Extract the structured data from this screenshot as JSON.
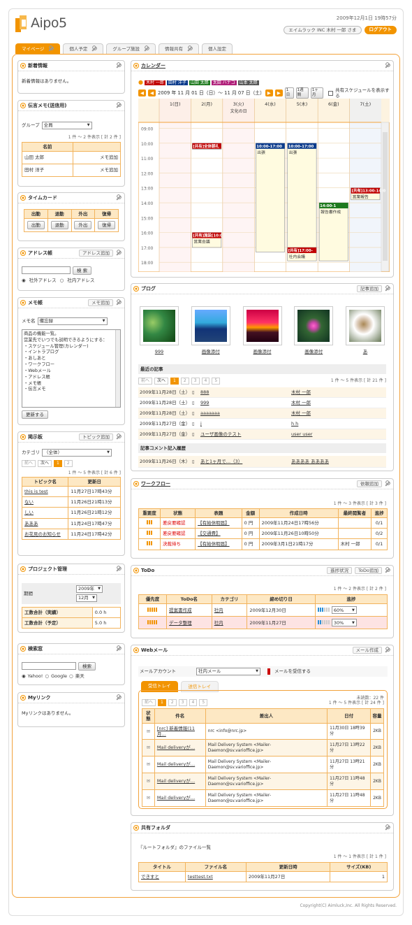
{
  "header": {
    "app": "Aipo5",
    "date": "2009年12月1日 19時57分",
    "user": "エイムラック INC 木村 一郎 さま",
    "logout": "ログアウト",
    "brand_colors": {
      "accent": "#f29400",
      "accent_light": "#fde8c4"
    }
  },
  "tabs": [
    {
      "label": "マイページ"
    },
    {
      "label": "個人予定"
    },
    {
      "label": "グループ施設"
    },
    {
      "label": "情報共有"
    },
    {
      "label": "個人設定"
    }
  ],
  "left": {
    "news": {
      "title": "新着情報",
      "empty": "新着情報はありません。"
    },
    "memo": {
      "title": "伝言メモ(送信用)",
      "group_label": "グループ",
      "group_value": "全員",
      "count": "1 件 ～ 2 件表示 [ 計 2 件 ]",
      "col": "名前",
      "rows": [
        {
          "name": "山田 太郎",
          "action": "メモ追加"
        },
        {
          "name": "田村 洋子",
          "action": "メモ追加"
        }
      ]
    },
    "timecard": {
      "title": "タイムカード",
      "headers": [
        "出勤",
        "退勤",
        "外出",
        "復帰"
      ],
      "buttons": [
        "出勤",
        "退勤",
        "外出",
        "復帰"
      ]
    },
    "address": {
      "title": "アドレス帳",
      "add": "アドレス追加",
      "search": "検 索",
      "r1": "社外アドレス",
      "r2": "社内アドレス"
    },
    "notepad": {
      "title": "メモ帳",
      "add": "メモ追加",
      "label": "メモ名",
      "value": "備忘録",
      "text": [
        "商品の機能一覧。",
        "営業先でいつでも説明できるようにする：",
        "・スケジュール管理(カレンダー)",
        "・イントラブログ",
        "・あしあと",
        "・ワークフロー",
        "・Webメール",
        "・アドレス帳",
        "・メモ帳",
        "・伝言メモ"
      ],
      "update": "更新する"
    },
    "board": {
      "title": "掲示板",
      "add": "トピック追加",
      "cat_label": "カテゴリ",
      "cat_value": "（全体）",
      "prev": "前へ",
      "next": "次へ",
      "p1": "1",
      "p2": "2",
      "count": "1 件 ～ 5 件表示 [ 計 6 件 ]",
      "h1": "トピック名",
      "h2": "更新日",
      "rows": [
        {
          "t": "this is test",
          "d": "11月27日17時43分"
        },
        {
          "t": "ない",
          "d": "11月26日21時13分"
        },
        {
          "t": "しい",
          "d": "11月26日21時12分"
        },
        {
          "t": "あああ",
          "d": "11月24日17時47分"
        },
        {
          "t": "お花見のお知らせ",
          "d": "11月24日17時42分"
        }
      ]
    },
    "project": {
      "title": "プロジェクト管理",
      "period": "期間",
      "year": "2009年",
      "month": "12月",
      "rows": [
        {
          "l": "工数合計（実績）",
          "v": "0.0 h"
        },
        {
          "l": "工数合計（予定）",
          "v": "5.0 h"
        }
      ]
    },
    "search": {
      "title": "検索窓",
      "btn": "検索",
      "r1": "Yahoo!",
      "r2": "Google",
      "r3": "楽天"
    },
    "links": {
      "title": "Myリンク",
      "empty": "Myリンクはありません。"
    }
  },
  "calendar": {
    "title": "カレンダー",
    "people": [
      {
        "n": "木村 一郎",
        "c": "#c00000"
      },
      {
        "n": "田村 洋子",
        "c": "#0b3b8c"
      },
      {
        "n": "山田 太郎",
        "c": "#1e7a1e"
      },
      {
        "n": "太田 ハナコ",
        "c": "#b0207a"
      },
      {
        "n": "山本 太郎",
        "c": "#555555"
      }
    ],
    "range": "2009 年 11 月 01 日（日）～ 11 月 07 日（土）",
    "shared": "共有スケジュールを表示する",
    "views": [
      "1日",
      "1週間",
      "1ヶ月"
    ],
    "days": [
      "1(日)",
      "2(月)",
      "3(火)",
      "4(水)",
      "5(木)",
      "6(金)",
      "7(土)"
    ],
    "holiday": "文化の日",
    "hours": [
      "09:00",
      "10:00",
      "11:00",
      "12:00",
      "13:00",
      "14:00",
      "15:00",
      "16:00",
      "17:00",
      "18:00"
    ],
    "events": [
      {
        "day": 1,
        "start": 10.0,
        "end": 10.4,
        "label": "[共有]全体朝礼",
        "c": "#c00000",
        "text": ""
      },
      {
        "day": 1,
        "start": 16.0,
        "end": 17.0,
        "label": "[共有]施設[10:0",
        "c": "#c00000",
        "text": "営業会議"
      },
      {
        "day": 3,
        "start": 10.0,
        "end": 17.3,
        "label": "10:00-17:00",
        "c": "#0b3b8c",
        "text": "出張"
      },
      {
        "day": 4,
        "start": 10.0,
        "end": 17.3,
        "label": "10:00-17:00",
        "c": "#0b3b8c",
        "text": "出張"
      },
      {
        "day": 4,
        "start": 17.0,
        "end": 17.9,
        "label": "[共有]17:00-",
        "c": "#c00000",
        "text": "社内会議"
      },
      {
        "day": 5,
        "start": 14.0,
        "end": 17.9,
        "label": "14:00-1",
        "c": "#1e7a1e",
        "text": "報告書作成"
      },
      {
        "day": 6,
        "start": 13.0,
        "end": 13.8,
        "label": "[共有]13:00-14:0",
        "c": "#c00000",
        "text": "営業報告"
      }
    ]
  },
  "blog": {
    "title": "ブログ",
    "add": "記事追加",
    "thumbs": [
      "999",
      "画像添付",
      "画像添付",
      "画像添付",
      "あ"
    ],
    "recent": "最近の記事",
    "count": "1 件 ～ 5 件表示 [ 計 21 件 ]",
    "pages": [
      "1",
      "2",
      "3",
      "4",
      "5"
    ],
    "prev": "前へ",
    "next": "次へ",
    "rows": [
      {
        "d": "2009年11月28日（土）",
        "t": "888",
        "a": "木村 一郎"
      },
      {
        "d": "2009年11月28日（土）",
        "t": "999",
        "a": "木村 一郎"
      },
      {
        "d": "2009年11月28日（土）",
        "t": "aaaaaaa",
        "a": "木村 一郎"
      },
      {
        "d": "2009年11月27日（金）",
        "t": "j",
        "a": "h h"
      },
      {
        "d": "2009年11月27日（金）",
        "t": "ユーザ画像のテスト",
        "a": "user user"
      }
    ],
    "comments": "記事コメント記入履歴",
    "crow": {
      "d": "2009年11月26日（木）",
      "t": "あと1ヶ月で…（3）",
      "a": "ああああ ああああ"
    }
  },
  "workflow": {
    "title": "ワークフロー",
    "add": "依頼追加",
    "count": "1 件 ～ 3 件表示 [ 計 3 件 ]",
    "headers": [
      "重要度",
      "状態",
      "表題",
      "金額",
      "作成日時",
      "最終閲覧者",
      "進捗"
    ],
    "rows": [
      {
        "s": "差戻要確認",
        "t": "【有給休暇届】",
        "m": "0 円",
        "d": "2009年11月24日17時56分",
        "v": "",
        "p": "0/1"
      },
      {
        "s": "差戻要確認",
        "t": "【交通費】",
        "m": "0 円",
        "d": "2009年11月26日10時50分",
        "v": "",
        "p": "0/2"
      },
      {
        "s": "決裁待ち",
        "t": "【有給休暇届】",
        "m": "0 円",
        "d": "2009年3月1日21時17分",
        "v": "木村 一郎",
        "p": "0/1"
      }
    ]
  },
  "todo": {
    "title": "ToDo",
    "status": "進捗状況",
    "add": "ToDo追加",
    "count": "1 件 ～ 2 件表示 [ 計 2 件 ]",
    "headers": [
      "優先度",
      "ToDo名",
      "カテゴリ",
      "締め切り日",
      "進捗"
    ],
    "rows": [
      {
        "n": "提案書作成",
        "c": "社内",
        "d": "2009年12月30日",
        "p": "60%",
        "f": 0.6
      },
      {
        "n": "データ整理",
        "c": "社内",
        "d": "2009年11月27日",
        "p": "30%",
        "f": 0.3
      }
    ]
  },
  "webmail": {
    "title": "Webメール",
    "add": "メール作成",
    "acc_label": "メールアカウント",
    "acc_value": "社内メール",
    "receive": "メールを受信する",
    "tab_in": "受信トレイ",
    "tab_out": "送信トレイ",
    "unread": "未読数：22 件",
    "count": "1 件 ～ 5 件表示 [ 計 24 件 ]",
    "pages": [
      "1",
      "2",
      "3",
      "4",
      "5"
    ],
    "prev": "前へ",
    "next": "次へ",
    "headers": [
      "状態",
      "件名",
      "差出人",
      "日付",
      "容量"
    ],
    "rows": [
      {
        "s": "[nrc] 新着情報(11月…",
        "f": "nrc <info@nrc.jp>",
        "d": "11月30日 18時39分",
        "z": "2KB"
      },
      {
        "s": "Mail deliveryが…",
        "f": "Mail Delivery System <Mailer-Daemon@sv.varioffice.jp>",
        "d": "11月27日 13時22分",
        "z": "2KB"
      },
      {
        "s": "Mail deliveryが…",
        "f": "Mail Delivery System <Mailer-Daemon@sv.varioffice.jp>",
        "d": "11月27日 13時21分",
        "z": "2KB"
      },
      {
        "s": "Mail deliveryが…",
        "f": "Mail Delivery System <Mailer-Daemon@sv.varioffice.jp>",
        "d": "11月27日 11時48分",
        "z": "2KB"
      },
      {
        "s": "Mail deliveryが…",
        "f": "Mail Delivery System <Mailer-Daemon@sv.varioffice.jp>",
        "d": "11月27日 11時48分",
        "z": "2KB"
      }
    ]
  },
  "folder": {
    "title": "共有フォルダ",
    "path": "『ルートフォルダ』のファイル一覧",
    "count": "1 件 ～ 1 件表示 [ 計 1 件 ]",
    "headers": [
      "タイトル",
      "ファイル名",
      "更新日時",
      "サイズ(KB)"
    ],
    "rows": [
      {
        "t": "できすと",
        "f": "testtest.txt",
        "d": "2009年11月27日",
        "s": "1"
      }
    ]
  },
  "footer": "Copyright(C) Aimluck,Inc. All Rights Reserved."
}
